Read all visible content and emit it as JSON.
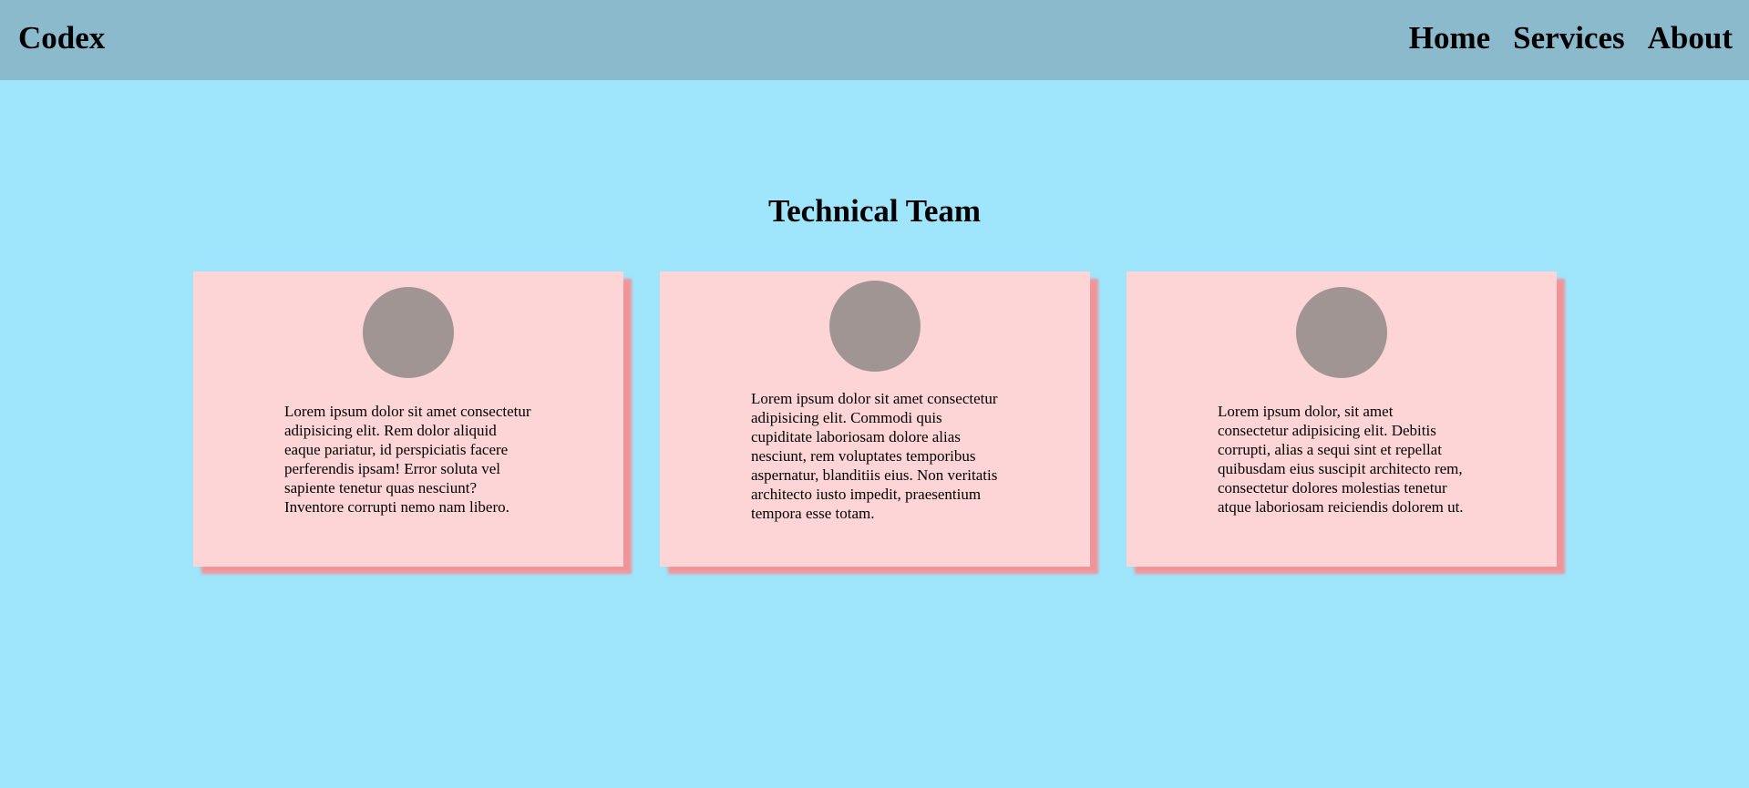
{
  "navbar": {
    "brand": "Codex",
    "links": [
      {
        "label": "Home"
      },
      {
        "label": "Services"
      },
      {
        "label": "About"
      }
    ]
  },
  "main": {
    "title": "Technical Team",
    "cards": [
      {
        "text": "Lorem ipsum dolor sit amet consectetur adipisicing elit. Rem dolor aliquid eaque pariatur, id perspiciatis facere perferendis ipsam! Error soluta vel sapiente tenetur quas nesciunt? Inventore corrupti nemo nam libero."
      },
      {
        "text": "Lorem ipsum dolor sit amet consectetur adipisicing elit. Commodi quis cupiditate laboriosam dolore alias nesciunt, rem voluptates temporibus aspernatur, blanditiis eius. Non veritatis architecto iusto impedit, praesentium tempora esse totam."
      },
      {
        "text": "Lorem ipsum dolor, sit amet consectetur adipisicing elit. Debitis corrupti, alias a sequi sint et repellat quibusdam eius suscipit architecto rem, consectetur dolores molestias tenetur atque laboriosam reiciendis dolorem ut."
      }
    ]
  },
  "colors": {
    "page_background": "#9fe5fc",
    "navbar_background": "#8abacc",
    "card_background": "#fed5d6",
    "card_shadow": "#f09597",
    "avatar": "#a09593"
  }
}
